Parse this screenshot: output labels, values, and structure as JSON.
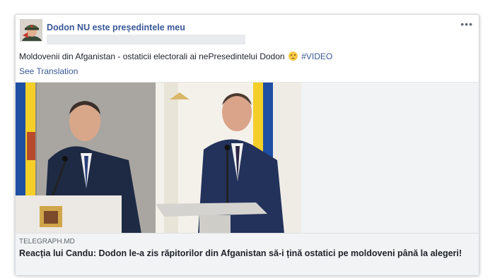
{
  "post": {
    "page_name": "Dodon NU este președintele meu",
    "text_before": "Moldovenii din Afganistan - ostaticii electorali ai nePresedintelui Dodon",
    "emoji_icon": "disappointed-face-emoji",
    "hashtag": "#VIDEO",
    "see_translation": "See Translation",
    "more_icon": "more-options-icon",
    "more_glyph": "•••"
  },
  "link": {
    "domain": "TELEGRAPH.MD",
    "headline": "Reacția lui Candu: Dodon le-a zis răpitorilor din Afganistan să-i țină ostatici pe moldoveni până la alegeri!"
  },
  "colors": {
    "link_blue": "#385898",
    "text": "#1d2129",
    "meta": "#606770",
    "panel_bg": "#f2f3f5"
  }
}
